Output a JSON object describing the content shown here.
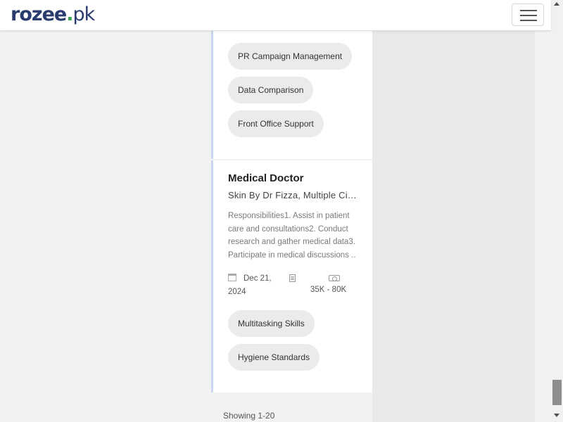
{
  "header": {
    "logo": {
      "part1": "rozee",
      "dot": ".",
      "part2": "pk"
    },
    "menu_icon": "hamburger-icon"
  },
  "feed": {
    "card1": {
      "skills": [
        "PR Campaign Management",
        "Data Comparison",
        "Front Office Support"
      ]
    },
    "card2": {
      "title": "Medical Doctor",
      "company": "Skin By Dr Fizza, Multiple Cities, Pakistan",
      "description": "Responsibilities1. Assist in patient care and consultations2. Conduct research and gather medical data3. Participate in medical discussions ..",
      "date": "Dec 21, 2024",
      "salary": "35K - 80K",
      "skills": [
        "Multitasking Skills",
        "Hygiene Standards"
      ],
      "icons": {
        "date": "calendar-icon",
        "type": "document-icon",
        "salary": "money-icon"
      }
    },
    "showing": "Showing 1-20"
  },
  "colors": {
    "brand_navy": "#2a3c6e",
    "brand_green": "#3aa655",
    "card_accent": "#c8d6ef",
    "chip_bg": "#ebebeb"
  }
}
